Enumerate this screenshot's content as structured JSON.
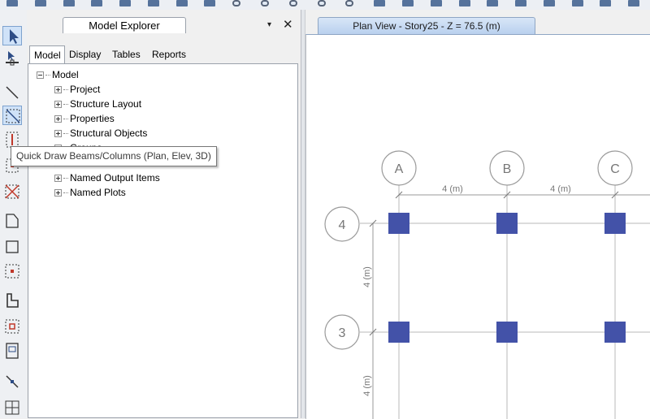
{
  "toolbar": {
    "icons": [
      "toolbar-icon",
      "toolbar-icon",
      "toolbar-icon",
      "undo-icon",
      "redo-icon",
      "pencil-icon",
      "lock-icon",
      "arrow-icon",
      "zoom-in-icon",
      "zoom-out-icon",
      "zoom-window-icon",
      "zoom-previous-icon",
      "zoom-fit-icon",
      "pan-icon",
      "3d-view-icon",
      "plan-view-icon",
      "elevation-view-icon",
      "rotate-icon",
      "binoculars-icon",
      "display-icon",
      "shading-icon",
      "grid-icon",
      "options-icon"
    ]
  },
  "explorer": {
    "title": "Model Explorer",
    "pin_glyph": "▾",
    "close_glyph": "✕",
    "tabs": [
      {
        "label": "Model",
        "active": true
      },
      {
        "label": "Display",
        "active": false
      },
      {
        "label": "Tables",
        "active": false
      },
      {
        "label": "Reports",
        "active": false
      }
    ],
    "root": "Model",
    "items": [
      "Project",
      "Structure Layout",
      "Properties",
      "Structural Objects",
      "Groups",
      "Named Output Items",
      "Named Plots"
    ]
  },
  "tooltip": {
    "text": "Quick Draw Beams/Columns (Plan, Elev, 3D)"
  },
  "plan": {
    "tab_title": "Plan View - Story25 - Z = 76.5 (m)",
    "grid_columns": [
      "A",
      "B",
      "C"
    ],
    "grid_rows": [
      "4",
      "3"
    ],
    "spacing_labels": [
      "4 (m)",
      "4 (m)",
      "4 (m)",
      "4 (m)"
    ],
    "colors": {
      "column_fill": "#4352a8",
      "grid_line": "#b8b8b8",
      "bubble": "#9a9a9a"
    }
  },
  "left_tools": [
    {
      "name": "select-pointer-icon",
      "active": true
    },
    {
      "name": "reshape-pointer-icon",
      "active": false
    },
    {
      "name": "draw-line-icon",
      "active": false
    },
    {
      "name": "quick-draw-beams-icon",
      "active": true
    },
    {
      "name": "draw-column-icon",
      "active": false
    },
    {
      "name": "quick-column-icon",
      "active": false
    },
    {
      "name": "draw-brace-icon",
      "active": false
    },
    {
      "name": "draw-floor-icon",
      "active": false
    },
    {
      "name": "draw-rectangular-floor-icon",
      "active": false
    },
    {
      "name": "quick-floor-icon",
      "active": false
    },
    {
      "name": "draw-wall-icon",
      "active": false
    },
    {
      "name": "quick-wall-icon",
      "active": false
    },
    {
      "name": "draw-opening-icon",
      "active": false
    },
    {
      "name": "draw-link-icon",
      "active": false
    },
    {
      "name": "draw-grid-icon",
      "active": false
    }
  ]
}
